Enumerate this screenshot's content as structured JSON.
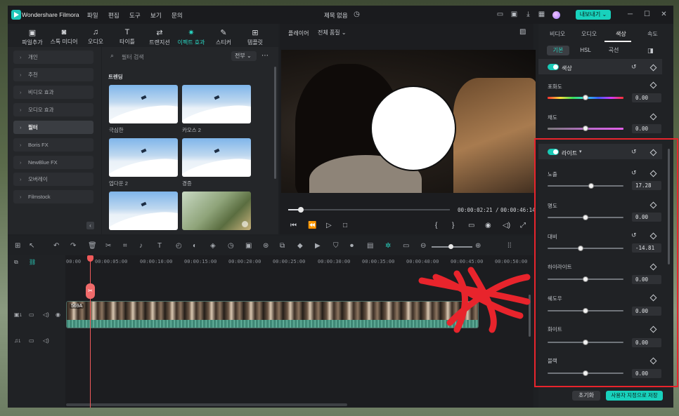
{
  "app": {
    "title": "Wondershare Filmora",
    "doc_title": "제목 없음",
    "export_label": "내보내기"
  },
  "menu": [
    "파일",
    "편집",
    "도구",
    "보기",
    "문의"
  ],
  "toolbar": [
    "파일추가",
    "스톡 미디어",
    "오디오",
    "타이틀",
    "트랜지션",
    "이펙트 효과",
    "스티커",
    "템플릿"
  ],
  "toolbar_active": "이펙트 효과",
  "library": {
    "categories": [
      "개인",
      "추천",
      "비디오 효과",
      "오디오 효과",
      "필터",
      "Boris FX",
      "NewBlue FX",
      "오버레이",
      "Filmstock"
    ],
    "active_category": "필터",
    "search_placeholder": "필터 검색",
    "filter_select": "전부",
    "section_title": "트렌딩",
    "items": [
      "극심한",
      "카오스 2",
      "업다운 2",
      "경증",
      "",
      ""
    ]
  },
  "player": {
    "label": "플레이어",
    "quality": "전체 품질",
    "current_time": "00:00:02:21",
    "separator": "/",
    "total_time": "00:00:46:14",
    "progress": 0.04
  },
  "timeline": {
    "ruler": [
      "00:00",
      "00:00:05:00",
      "00:00:10:00",
      "00:00:15:00",
      "00:00:20:00",
      "00:00:25:00",
      "00:00:30:00",
      "00:00:35:00",
      "00:00:40:00",
      "00:00:45:00",
      "00:00:50:00"
    ],
    "clip_label": "569A",
    "video_track": "1",
    "audio_track": "1"
  },
  "inspector": {
    "tabs": [
      "비디오",
      "오디오",
      "색상",
      "속도"
    ],
    "active_tab": "색상",
    "subtabs": [
      "기본",
      "HSL",
      "곡선"
    ],
    "active_subtab": "기본",
    "color_section": "색상",
    "color_params": [
      {
        "label": "포화도",
        "value": "0.00",
        "position": 0.5
      },
      {
        "label": "채도",
        "value": "0.00",
        "position": 0.5
      }
    ],
    "light_section": "라이트",
    "light_params": [
      {
        "label": "노출",
        "value": "17.28",
        "position": 0.57
      },
      {
        "label": "명도",
        "value": "0.00",
        "position": 0.5
      },
      {
        "label": "대비",
        "value": "-14.81",
        "position": 0.43
      },
      {
        "label": "하이라이트",
        "value": "0.00",
        "position": 0.5
      },
      {
        "label": "쉐도우",
        "value": "0.00",
        "position": 0.5
      },
      {
        "label": "화이트",
        "value": "0.00",
        "position": 0.5
      },
      {
        "label": "블랙",
        "value": "0.00",
        "position": 0.5
      }
    ],
    "reset_label": "초기화",
    "save_label": "사용자 지정으로 저장"
  },
  "colors": {
    "accent": "#18d1bc",
    "playhead": "#f05a5a",
    "annotation": "#e8242c"
  }
}
